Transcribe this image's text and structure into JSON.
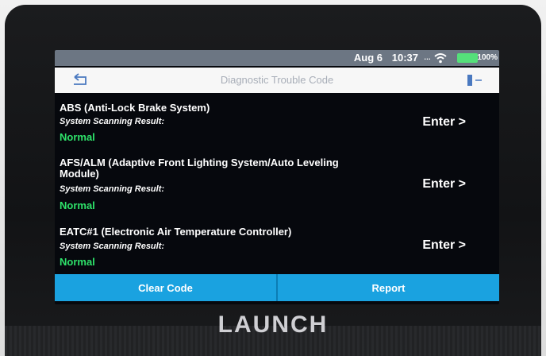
{
  "statusbar": {
    "date": "Aug 6",
    "time": "10:37",
    "signal_text": "…",
    "battery": "100%",
    "colors": {
      "battery_fill": "#55e07a"
    }
  },
  "header": {
    "title": "Diagnostic Trouble Code",
    "back_icon": "back-arrow-icon",
    "exit_icon": "exit-icon"
  },
  "systems": [
    {
      "name": "ABS (Anti-Lock Brake System)",
      "scan_label": "System Scanning Result:",
      "result": "Normal",
      "action": "Enter >"
    },
    {
      "name": "AFS/ALM (Adaptive Front Lighting System/Auto Leveling Module)",
      "scan_label": "System Scanning Result:",
      "result": "Normal",
      "action": "Enter >"
    },
    {
      "name": "EATC#1 (Electronic Air Temperature Controller)",
      "scan_label": "System Scanning Result:",
      "result": "Normal",
      "action": "Enter >"
    }
  ],
  "footer": {
    "clear_code": "Clear Code",
    "report": "Report",
    "accent": "#1aa2e0"
  },
  "device": {
    "brand": "LAUNCH"
  }
}
